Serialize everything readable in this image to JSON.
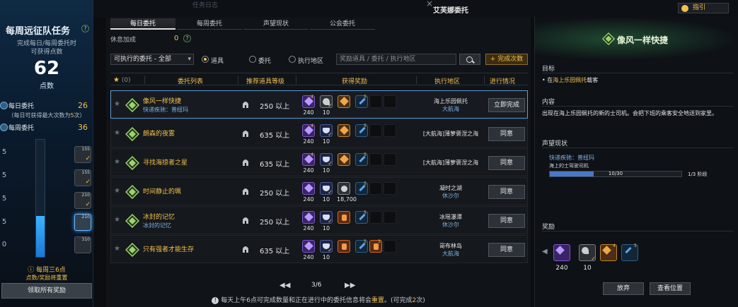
{
  "left": {
    "title": "每周远征队任务",
    "help": "?",
    "sub1": "完成每日/每周委托时",
    "sub2": "可获得点数",
    "points": "62",
    "points_unit": "点数",
    "daily_label": "每日委托",
    "daily_value": "26",
    "daily_note_pre": "（每日可获得最大次数为",
    "daily_note_num": "5",
    "daily_note_post": "次）",
    "weekly_label": "每周委托",
    "weekly_value": "36",
    "progress_fraction": 0.35,
    "tiers": [
      "5",
      "5",
      "5",
      "5",
      "0"
    ],
    "tier_levels": [
      "155",
      "155",
      "210",
      "210",
      "310"
    ],
    "warn": "每周三6点",
    "warn2": "点数/奖励将重置",
    "claim": "领取所有奖励"
  },
  "topbar": {
    "window_title": "艾芙娜委托",
    "ghost_title": "任务日志",
    "close": "×",
    "guide": "指引"
  },
  "tabs": [
    "每日委托",
    "每周委托",
    "声望现状",
    "公会委托"
  ],
  "rest": {
    "label": "休息加成",
    "value": "0",
    "help": "?"
  },
  "filter": {
    "selected": "可执行的委托 - 全部",
    "arrow": "▾"
  },
  "radios": [
    {
      "label": "道具",
      "on": true
    },
    {
      "label": "委托",
      "on": false
    },
    {
      "label": "执行地区",
      "on": false
    }
  ],
  "search": {
    "placeholder": "奖励道具 / 委托 / 执行地区"
  },
  "done_button": "+ 完成次数",
  "table": {
    "fav_count": "(0)",
    "headers": [
      "委托列表",
      "推荐道具等级",
      "获得奖励",
      "执行地区",
      "进行情况"
    ],
    "rows": [
      {
        "name": "像风一样快捷",
        "sub": "快递疾驰：普纽玛",
        "level": "250 以上",
        "rewards": [
          "purple",
          "gray",
          "gold",
          "blue",
          "dark",
          "dark"
        ],
        "counts": [
          "4",
          "",
          "",
          "5"
        ],
        "qty": [
          "240",
          "10"
        ],
        "loc": "海上乐园佩托",
        "loc2": "大航海",
        "action": "立即完成",
        "selected": true
      },
      {
        "name": "朗森的夜雾",
        "sub": "",
        "level": "635 以上",
        "rewards": [
          "purple",
          "gem",
          "gold",
          "blue",
          "dark",
          "dark"
        ],
        "counts": [
          "4",
          "",
          "",
          "5"
        ],
        "qty": [
          "240",
          "10"
        ],
        "loc": "[大航海]薄萝褒涅之海",
        "loc2": "",
        "action": "同意",
        "selected": false
      },
      {
        "name": "寻找海掠者之星",
        "sub": "",
        "level": "635 以上",
        "rewards": [
          "purple",
          "gem",
          "gold",
          "blue",
          "dark",
          "dark"
        ],
        "counts": [
          "4",
          "",
          "",
          "5"
        ],
        "qty": [
          "240",
          "10"
        ],
        "loc": "[大航海]薄萝褒涅之海",
        "loc2": "",
        "action": "同意",
        "selected": false
      },
      {
        "name": "时间静止的珮",
        "sub": "",
        "level": "250 以上",
        "rewards": [
          "purple",
          "gem",
          "silver",
          "blue",
          "dark",
          "dark"
        ],
        "counts": [
          "",
          "",
          "",
          "5"
        ],
        "qty": [
          "240",
          "10",
          "18,700"
        ],
        "loc": "凝时之湖",
        "loc2": "休沙尔",
        "action": "同意",
        "selected": false
      },
      {
        "name": "冰封的记忆",
        "sub": "冰封的记忆",
        "level": "250 以上",
        "rewards": [
          "purple",
          "gem",
          "orange",
          "blue",
          "dark",
          "dark"
        ],
        "counts": [
          "",
          "",
          "",
          "5"
        ],
        "qty": [
          "240",
          "10"
        ],
        "loc": "冰瑶瀑潭",
        "loc2": "休沙尔",
        "action": "同意",
        "selected": false
      },
      {
        "name": "只有强者才能生存",
        "sub": "",
        "level": "635 以上",
        "rewards": [
          "purple",
          "gem",
          "orange",
          "blue",
          "orange",
          "dark"
        ],
        "counts": [
          "",
          "",
          "",
          "5",
          "3"
        ],
        "qty": [
          "240",
          "10"
        ],
        "loc": "哥布林岛",
        "loc2": "大航海",
        "action": "同意",
        "selected": false
      }
    ]
  },
  "pager": {
    "first": "◀◀",
    "prev": "◀",
    "page": "3/6",
    "next": "▶",
    "last": "▶▶"
  },
  "footer": {
    "pre": "每天上午6点可完成数量和正在进行中的委托信息将会",
    "hl": "重置",
    "post": "。(可完成",
    "num": "2",
    "end": "次)"
  },
  "right": {
    "title": "像风一样快捷",
    "goal_label": "目标",
    "goal_pre": "• 在",
    "goal_hl": "海上乐园佩托",
    "goal_post": "载客",
    "content_label": "内容",
    "content_text": "出现在海上乐园佩托的新的士司机。会把下班的乘客安全地送到家里。",
    "rep_label": "声望现状",
    "rep_name": "快递疾驰：普纽玛",
    "rep_sub": "海上的士驾驶司机",
    "rep_progress": "10/30",
    "rep_fraction": 0.3333,
    "rep_stage": "1/3 阶段",
    "reward_label": "奖励",
    "reward_counts": [
      "4",
      "5"
    ],
    "reward_qty": [
      "240",
      "10"
    ],
    "btn_abandon": "放弃",
    "btn_locate": "查看位置"
  }
}
